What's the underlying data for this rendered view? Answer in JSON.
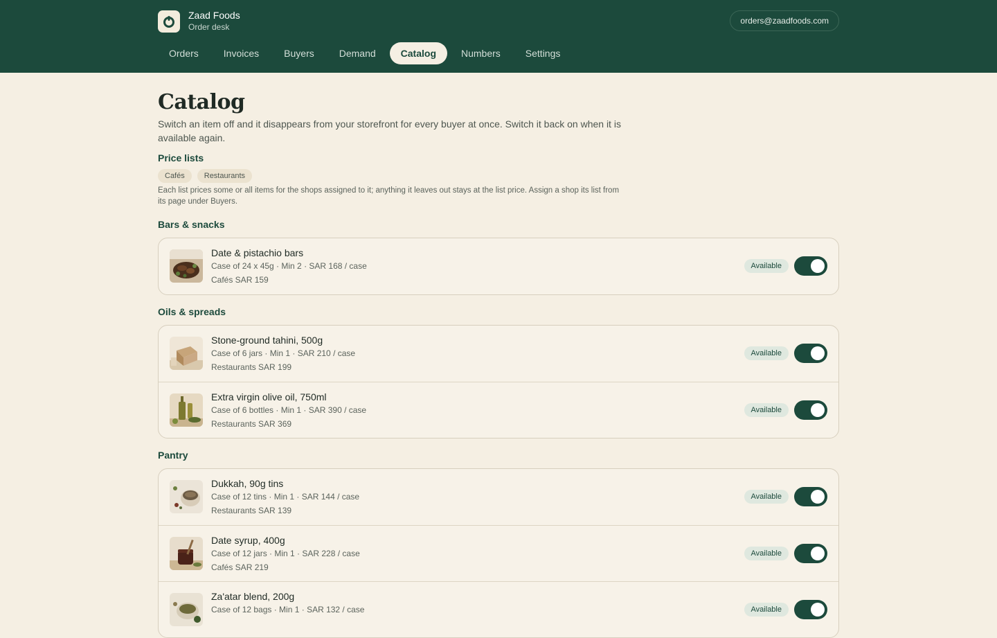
{
  "app": {
    "name": "Zaad Foods",
    "subtitle": "Order desk",
    "account_email": "orders@zaadfoods.com"
  },
  "nav": [
    "Orders",
    "Invoices",
    "Buyers",
    "Demand",
    "Catalog",
    "Numbers",
    "Settings"
  ],
  "nav_active": "Catalog",
  "page": {
    "title": "Catalog",
    "intro": "Switch an item off and it disappears from your storefront for every buyer at once. Switch it back on when it is available again."
  },
  "price_lists": {
    "heading": "Price lists",
    "chips": [
      "Cafés",
      "Restaurants"
    ],
    "note": "Each list prices some or all items for the shops assigned to it; anything it leaves out stays at the list price. Assign a shop its list from its page under Buyers."
  },
  "sections": [
    {
      "heading": "Bars & snacks",
      "items": [
        {
          "name": "Date & pistachio bars",
          "meta": "Case of 24 x 45g · Min 2 · SAR 168 / case",
          "price_list": "Cafés SAR 159",
          "status": "Available",
          "enabled": true,
          "thumb": "bars"
        }
      ]
    },
    {
      "heading": "Oils & spreads",
      "items": [
        {
          "name": "Stone-ground tahini, 500g",
          "meta": "Case of 6 jars · Min 1 · SAR 210 / case",
          "price_list": "Restaurants SAR 199",
          "status": "Available",
          "enabled": true,
          "thumb": "box"
        },
        {
          "name": "Extra virgin olive oil, 750ml",
          "meta": "Case of 6 bottles · Min 1 · SAR 390 / case",
          "price_list": "Restaurants SAR 369",
          "status": "Available",
          "enabled": true,
          "thumb": "bottle"
        }
      ]
    },
    {
      "heading": "Pantry",
      "items": [
        {
          "name": "Dukkah, 90g tins",
          "meta": "Case of 12 tins · Min 1 · SAR 144 / case",
          "price_list": "Restaurants SAR 139",
          "status": "Available",
          "enabled": true,
          "thumb": "tin"
        },
        {
          "name": "Date syrup, 400g",
          "meta": "Case of 12 jars · Min 1 · SAR 228 / case",
          "price_list": "Cafés SAR 219",
          "status": "Available",
          "enabled": true,
          "thumb": "jar"
        },
        {
          "name": "Za'atar blend, 200g",
          "meta": "Case of 12 bags · Min 1 · SAR 132 / case",
          "price_list": "",
          "status": "Available",
          "enabled": true,
          "thumb": "bowl"
        }
      ]
    }
  ]
}
